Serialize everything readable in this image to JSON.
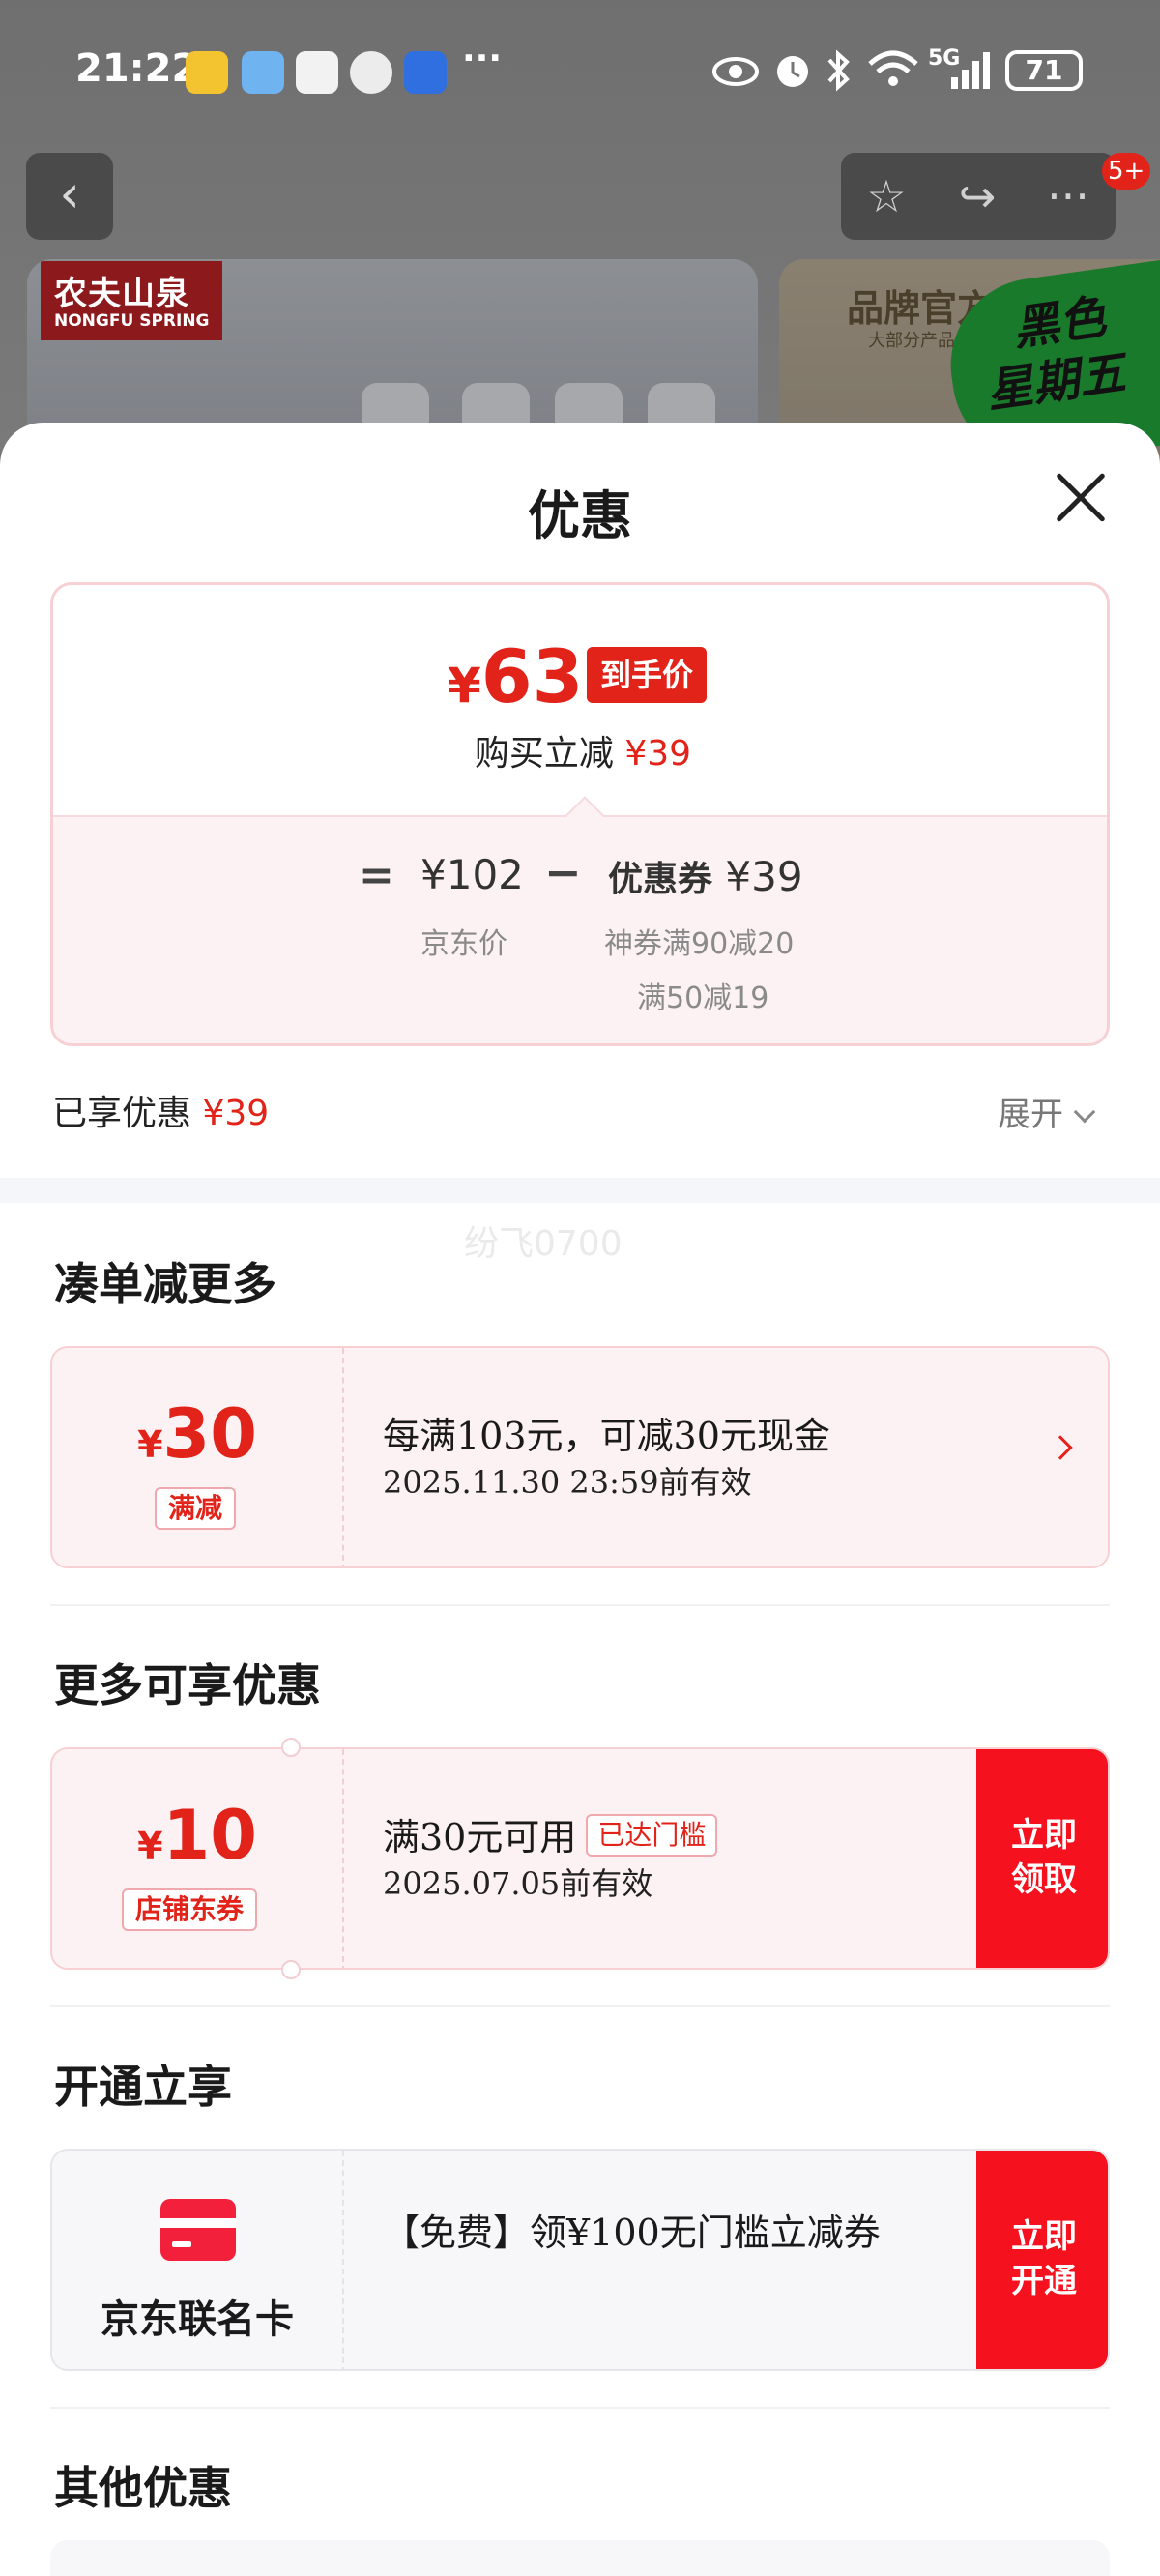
{
  "status_bar": {
    "time": "21:22",
    "more_apps": "···",
    "battery": "71",
    "signal": "5G",
    "icons": [
      "eye-icon",
      "alarm-icon",
      "bluetooth-icon",
      "wifi-icon",
      "signal-icon"
    ]
  },
  "product_bg": {
    "brand_cn": "农夫山泉",
    "brand_en": "NONGFU SPRING",
    "official_store": "品牌官方",
    "official_store_sub": "大部分产品",
    "promo_line1": "黑色",
    "promo_line2": "星期五",
    "notification_badge": "5+"
  },
  "sheet": {
    "title": "优惠",
    "price_card": {
      "currency": "¥",
      "final_price": "63",
      "final_tag": "到手价",
      "instant_prefix": "购买立减",
      "instant_amount": "¥39",
      "equals": "=",
      "jd_price": "¥102",
      "minus": "−",
      "coupon_label": "优惠券",
      "coupon_amount": "¥39",
      "jd_price_label": "京东价",
      "coupon_detail_1": "神券满90减20",
      "coupon_detail_2": "满50减19"
    },
    "enjoyed_label": "已享优惠",
    "enjoyed_amount": "¥39",
    "expand_label": "展开",
    "watermark": "纷飞0700",
    "sections": {
      "bundle_title": "凑单减更多",
      "more_title": "更多可享优惠",
      "open_title": "开通立享",
      "other_title": "其他优惠"
    },
    "bundle_coupon": {
      "currency": "¥",
      "amount": "30",
      "tag": "满减",
      "title": "每满103元，可减30元现金",
      "validity": "2025.11.30 23:59前有效"
    },
    "store_coupon": {
      "currency": "¥",
      "amount": "10",
      "tag": "店铺东券",
      "title": "满30元可用",
      "status_tag": "已达门槛",
      "validity": "2025.07.05前有效",
      "action_line1": "立即",
      "action_line2": "领取"
    },
    "card_offer": {
      "card_name": "京东联名卡",
      "offer": "【免费】领¥100无门槛立减券",
      "action_line1": "立即",
      "action_line2": "开通"
    }
  }
}
